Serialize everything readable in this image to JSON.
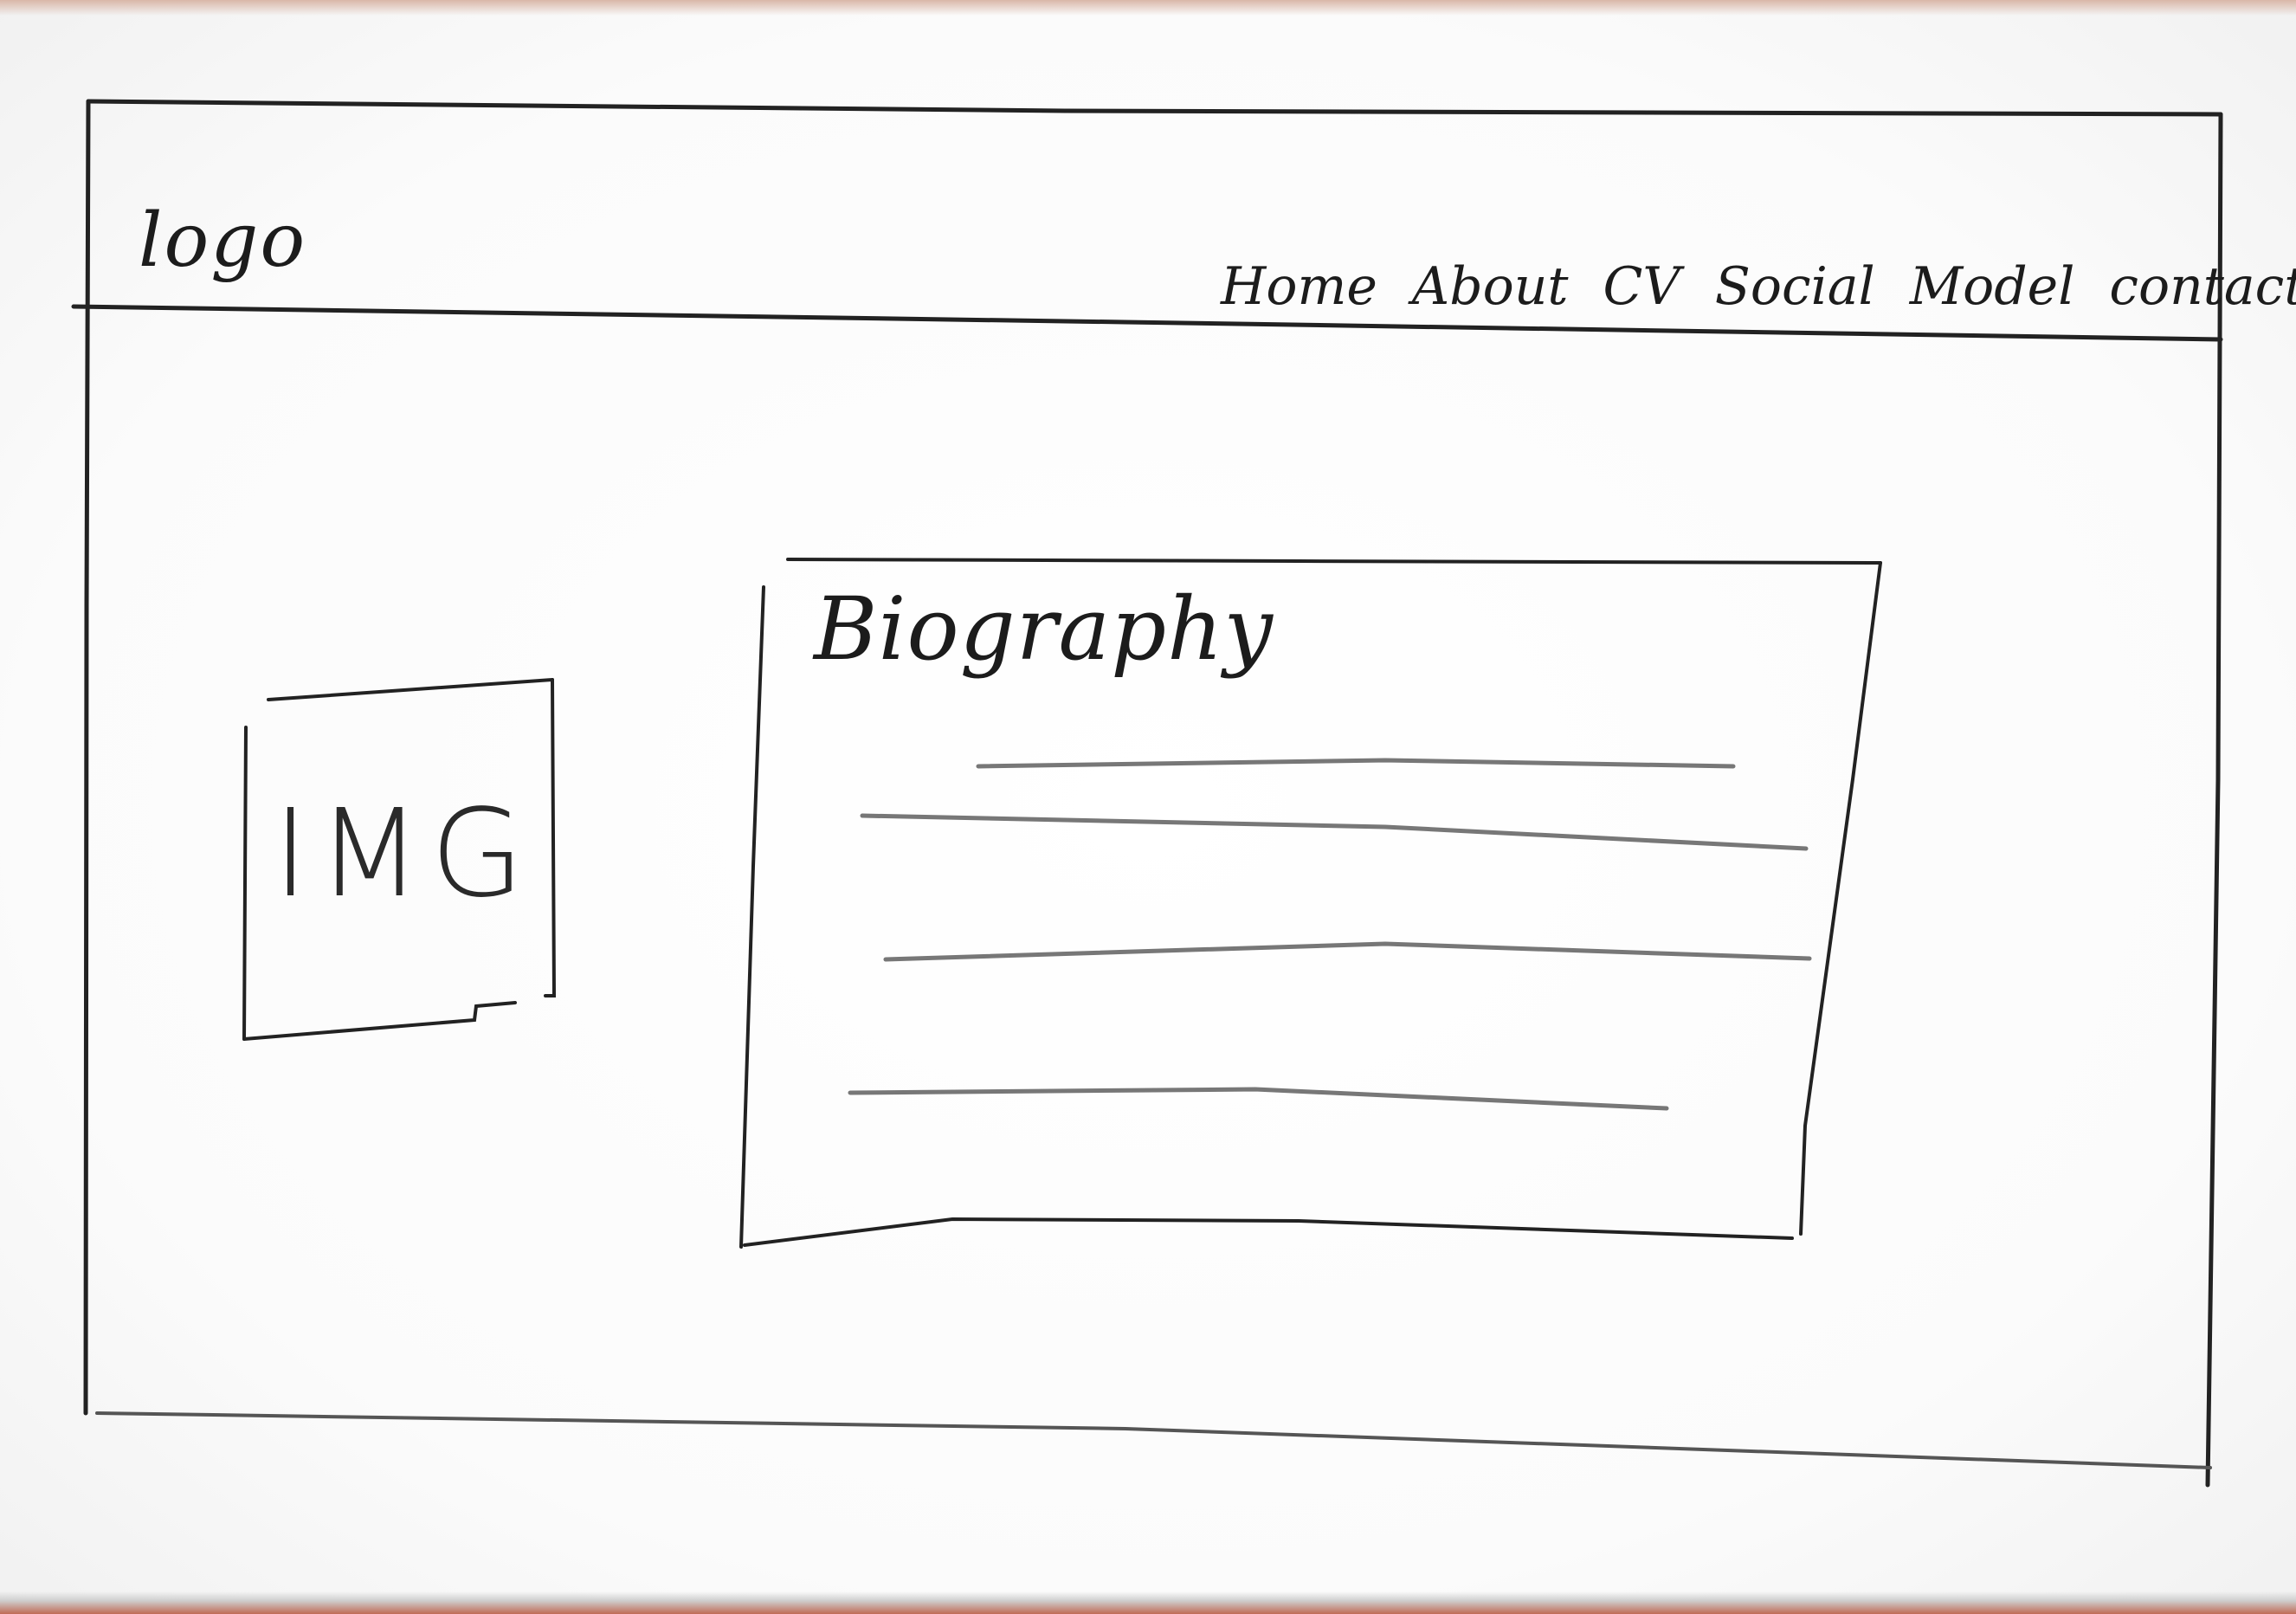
{
  "header": {
    "logo": "logo",
    "nav": [
      {
        "id": "home",
        "label": "Home"
      },
      {
        "id": "about",
        "label": "About"
      },
      {
        "id": "cv",
        "label": "CV"
      },
      {
        "id": "social",
        "label": "Social"
      },
      {
        "id": "model",
        "label": "Model"
      },
      {
        "id": "contact",
        "label": "contact"
      }
    ]
  },
  "main": {
    "image_placeholder": "IMG",
    "biography": {
      "title": "Biography",
      "text_lines": 4
    }
  },
  "colors": {
    "ink": "#1c1c1c",
    "pencil": "#4a4a4a",
    "paper": "#fdfdfd"
  }
}
